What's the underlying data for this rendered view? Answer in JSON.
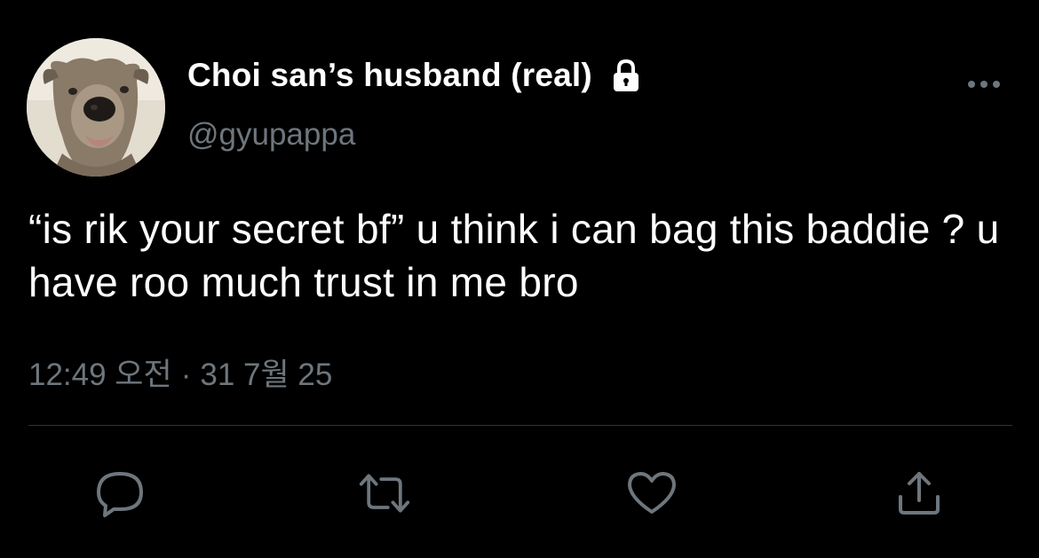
{
  "tweet": {
    "author": {
      "display_name": "Choi san’s husband (real)",
      "handle": "@gyupappa",
      "protected_icon": "lock-icon",
      "avatar": "dog-photo-avatar"
    },
    "text": "“is rik your secret bf” u think i can bag this baddie ? u have roo much trust in me bro",
    "meta": {
      "time": "12:49 오전",
      "separator": "·",
      "date": "31 7월 25"
    },
    "actions": [
      {
        "name": "reply",
        "icon": "comment-icon"
      },
      {
        "name": "retweet",
        "icon": "retweet-icon"
      },
      {
        "name": "like",
        "icon": "heart-icon"
      },
      {
        "name": "share",
        "icon": "share-icon"
      }
    ],
    "more_icon": "more-dots-icon"
  },
  "colors": {
    "background": "#000000",
    "primary_text": "#ffffff",
    "secondary_text": "#6e767d",
    "divider": "#2f3336",
    "icon": "#6e767d"
  }
}
